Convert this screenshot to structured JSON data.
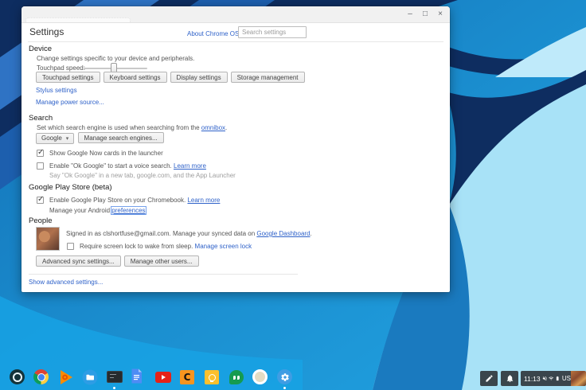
{
  "window": {
    "controls": {
      "minimize": "–",
      "maximize": "□",
      "close": "×"
    },
    "header": {
      "title": "Settings",
      "about_link": "About Chrome OS",
      "search_placeholder": "Search settings"
    },
    "device": {
      "heading": "Device",
      "description": "Change settings specific to your device and peripherals.",
      "touchpad_label": "Touchpad speed:",
      "buttons": [
        "Touchpad settings",
        "Keyboard settings",
        "Display settings",
        "Storage management"
      ],
      "stylus_link": "Stylus settings",
      "power_link": "Manage power source..."
    },
    "search": {
      "heading": "Search",
      "description_prefix": "Set which search engine is used when searching from the ",
      "omnibox_link": "omnibox",
      "description_suffix": ".",
      "engine_value": "Google",
      "manage_engines_button": "Manage search engines...",
      "google_now_label": "Show Google Now cards in the launcher",
      "ok_google_label": "Enable \"Ok Google\" to start a voice search.",
      "ok_google_learn_more": "Learn more",
      "ok_google_note": "Say \"Ok Google\" in a new tab, google.com, and the App Launcher"
    },
    "play_store": {
      "heading": "Google Play Store (beta)",
      "enable_label": "Enable Google Play Store on your Chromebook.",
      "learn_more": "Learn more",
      "manage_prefix": "Manage your Android ",
      "preferences_link": "preferences",
      "manage_suffix": "."
    },
    "people": {
      "heading": "People",
      "signed_in_prefix": "Signed in as clshortfuse@gmail.com. Manage your synced data on ",
      "dashboard_link": "Google Dashboard",
      "signed_in_suffix": ".",
      "screen_lock_label": "Require screen lock to wake from sleep.",
      "screen_lock_link": "Manage screen lock",
      "advanced_sync_button": "Advanced sync settings...",
      "manage_users_button": "Manage other users..."
    },
    "show_advanced_link": "Show advanced settings..."
  },
  "shelf": {
    "crunchyroll_letter": "C",
    "tray": {
      "time": "11:13",
      "keyboard_layout": "US"
    }
  },
  "icons": {
    "checkmark": "✓",
    "dropdown_arrow": "▾"
  },
  "colors": {
    "wallpaper_base": "#1b8fd0",
    "wallpaper_dark": "#0e2d60",
    "wallpaper_cyan": "#a8e2f7",
    "link_blue": "#2f62c9",
    "shelf_button": "#3a454c"
  }
}
